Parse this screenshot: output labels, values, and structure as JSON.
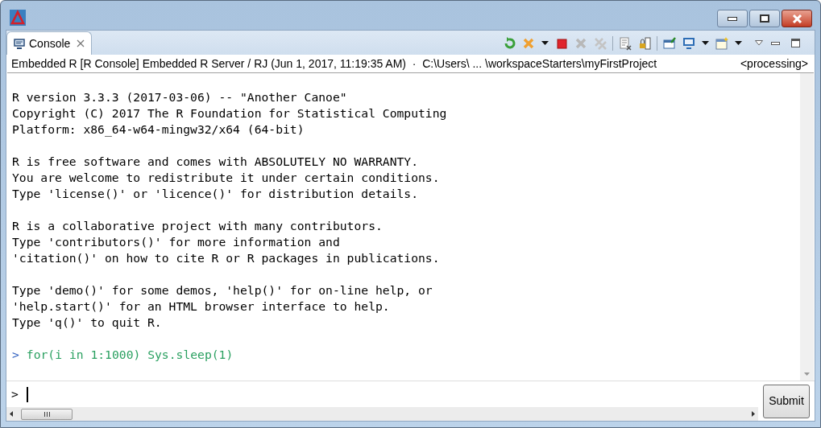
{
  "tab": {
    "label": "Console",
    "selected": true
  },
  "info": {
    "description": "Embedded R [R Console] Embedded R Server / RJ (Jun 1, 2017, 11:19:35 AM)  ·  C:\\Users\\ ... \\workspaceStarters\\myFirstProject",
    "status": "<processing>"
  },
  "output": [
    {
      "kind": "blank"
    },
    {
      "kind": "text",
      "text": "R version 3.3.3 (2017-03-06) -- \"Another Canoe\""
    },
    {
      "kind": "text",
      "text": "Copyright (C) 2017 The R Foundation for Statistical Computing"
    },
    {
      "kind": "text",
      "text": "Platform: x86_64-w64-mingw32/x64 (64-bit)"
    },
    {
      "kind": "blank"
    },
    {
      "kind": "text",
      "text": "R is free software and comes with ABSOLUTELY NO WARRANTY."
    },
    {
      "kind": "text",
      "text": "You are welcome to redistribute it under certain conditions."
    },
    {
      "kind": "text",
      "text": "Type 'license()' or 'licence()' for distribution details."
    },
    {
      "kind": "blank"
    },
    {
      "kind": "text",
      "text": "R is a collaborative project with many contributors."
    },
    {
      "kind": "text",
      "text": "Type 'contributors()' for more information and"
    },
    {
      "kind": "text",
      "text": "'citation()' on how to cite R or R packages in publications."
    },
    {
      "kind": "blank"
    },
    {
      "kind": "text",
      "text": "Type 'demo()' for some demos, 'help()' for on-line help, or"
    },
    {
      "kind": "text",
      "text": "'help.start()' for an HTML browser interface to help."
    },
    {
      "kind": "text",
      "text": "Type 'q()' to quit R."
    },
    {
      "kind": "blank"
    },
    {
      "kind": "input",
      "prompt": ">",
      "text": "for(i in 1:1000) Sys.sleep(1)"
    }
  ],
  "input": {
    "prompt": ">"
  },
  "submit": "Submit"
}
